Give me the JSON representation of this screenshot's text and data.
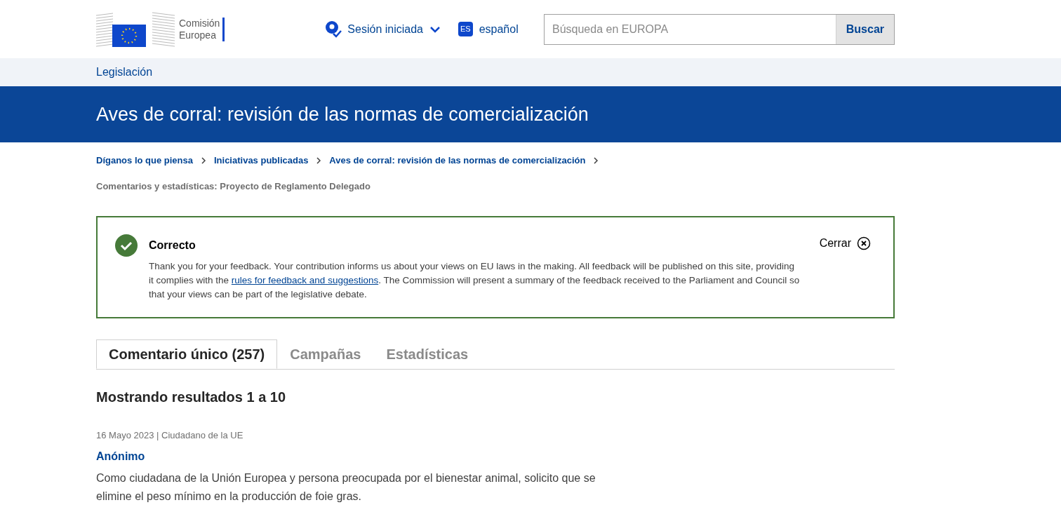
{
  "header": {
    "logo_text": [
      "Comisión",
      "Europea"
    ],
    "user_menu": "Sesión iniciada",
    "language_code": "ES",
    "language": "español",
    "search": {
      "placeholder": "Búsqueda en EUROPA",
      "button": "Buscar"
    }
  },
  "site_nav": "Legislación",
  "page_title": "Aves de corral: revisión de las normas de comercialización",
  "breadcrumbs": [
    "Díganos lo que piensa",
    "Iniciativas publicadas",
    "Aves de corral: revisión de las normas de comercialización"
  ],
  "current_page": "Comentarios y estadísticas: Proyecto de Reglamento Delegado",
  "message": {
    "title": "Correcto",
    "close": "Cerrar",
    "text_before": "Thank you for your feedback. Your contribution informs us about your views on EU laws in the making. All feedback will be published on this site, providing it complies with the",
    "link": "rules for feedback and suggestions",
    "text_after": ". The Commission will present a summary of the feedback received to the Parliament and Council so that your views can be part of the legislative debate."
  },
  "tabs": [
    {
      "label": "Comentario único (257)",
      "selected": true
    },
    {
      "label": "Campañas",
      "selected": false
    },
    {
      "label": "Estadísticas",
      "selected": false
    }
  ],
  "results_heading": "Mostrando resultados 1 a 10",
  "feedback": [
    {
      "meta": "16 Mayo 2023 | Ciudadano de la UE",
      "author": "Anónimo",
      "text": "Como ciudadana de la Unión Europea y persona preocupada por el bienestar animal, solicito que se elimine el peso mínimo en la producción de foie gras."
    }
  ]
}
